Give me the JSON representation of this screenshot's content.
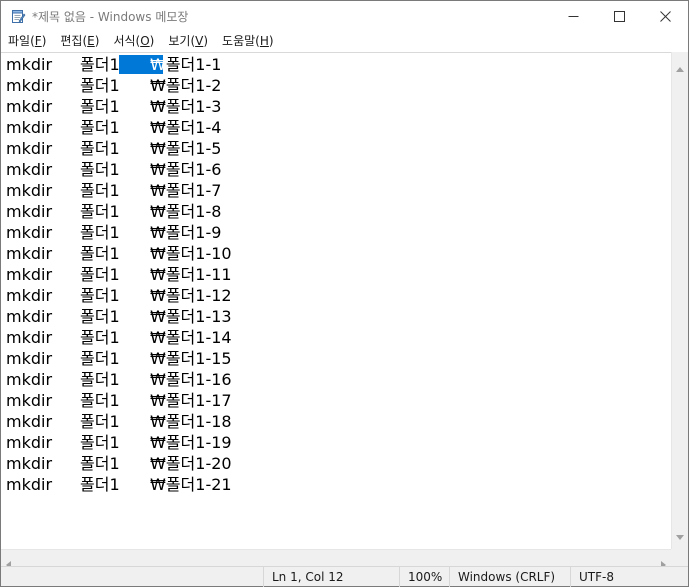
{
  "window": {
    "title": "*제목 없음 - Windows 메모장"
  },
  "menu": {
    "items": [
      {
        "label": "파일",
        "accel": "F"
      },
      {
        "label": "편집",
        "accel": "E"
      },
      {
        "label": "서식",
        "accel": "O"
      },
      {
        "label": "보기",
        "accel": "V"
      },
      {
        "label": "도움말",
        "accel": "H"
      }
    ]
  },
  "editor": {
    "lines": [
      [
        "mkdir",
        "폴더1",
        "₩폴더1-1"
      ],
      [
        "mkdir",
        "폴더1",
        "₩폴더1-2"
      ],
      [
        "mkdir",
        "폴더1",
        "₩폴더1-3"
      ],
      [
        "mkdir",
        "폴더1",
        "₩폴더1-4"
      ],
      [
        "mkdir",
        "폴더1",
        "₩폴더1-5"
      ],
      [
        "mkdir",
        "폴더1",
        "₩폴더1-6"
      ],
      [
        "mkdir",
        "폴더1",
        "₩폴더1-7"
      ],
      [
        "mkdir",
        "폴더1",
        "₩폴더1-8"
      ],
      [
        "mkdir",
        "폴더1",
        "₩폴더1-9"
      ],
      [
        "mkdir",
        "폴더1",
        "₩폴더1-10"
      ],
      [
        "mkdir",
        "폴더1",
        "₩폴더1-11"
      ],
      [
        "mkdir",
        "폴더1",
        "₩폴더1-12"
      ],
      [
        "mkdir",
        "폴더1",
        "₩폴더1-13"
      ],
      [
        "mkdir",
        "폴더1",
        "₩폴더1-14"
      ],
      [
        "mkdir",
        "폴더1",
        "₩폴더1-15"
      ],
      [
        "mkdir",
        "폴더1",
        "₩폴더1-16"
      ],
      [
        "mkdir",
        "폴더1",
        "₩폴더1-17"
      ],
      [
        "mkdir",
        "폴더1",
        "₩폴더1-18"
      ],
      [
        "mkdir",
        "폴더1",
        "₩폴더1-19"
      ],
      [
        "mkdir",
        "폴더1",
        "₩폴더1-20"
      ],
      [
        "mkdir",
        "폴더1",
        "₩폴더1-21"
      ]
    ],
    "selection_color": "#0078d7"
  },
  "status": {
    "position": "Ln 1, Col 12",
    "zoom": "100%",
    "line_ending": "Windows (CRLF)",
    "encoding": "UTF-8"
  },
  "icons": {
    "app": "notepad-icon",
    "minimize": "minimize-icon",
    "maximize": "maximize-icon",
    "close": "close-icon"
  }
}
